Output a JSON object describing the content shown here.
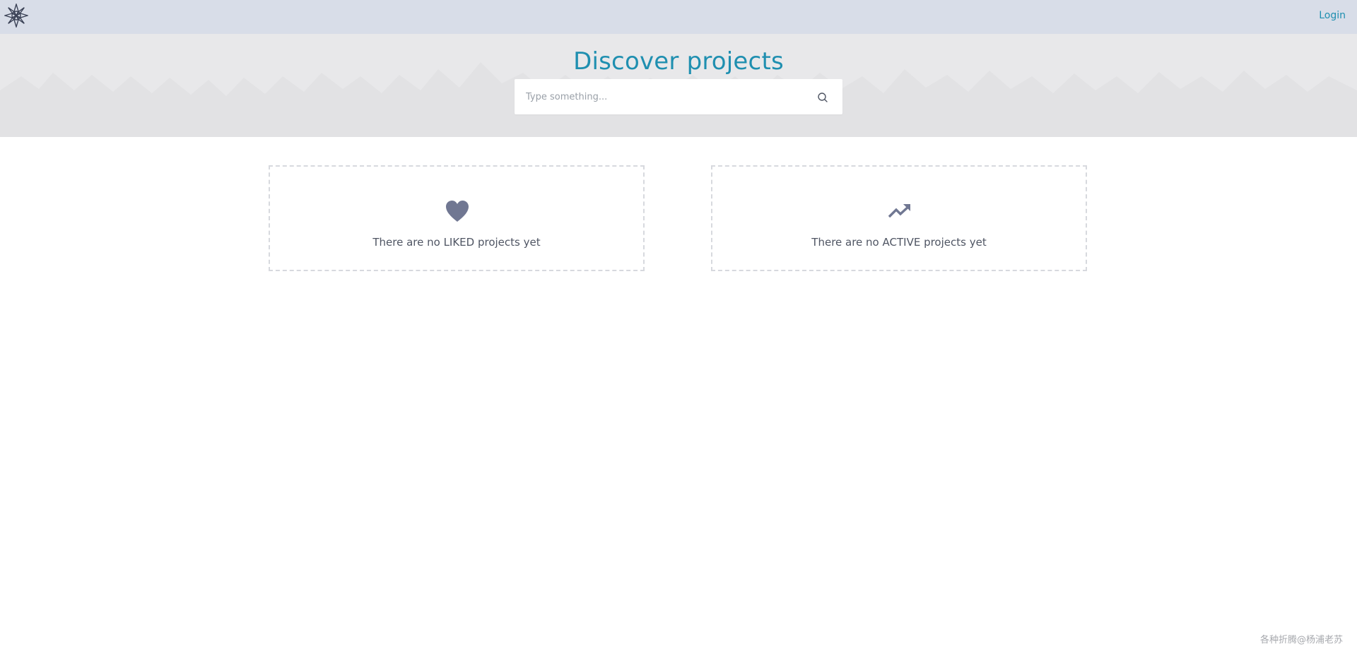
{
  "header": {
    "logo_icon": "snowflake-logo-icon",
    "login_label": "Login"
  },
  "hero": {
    "title": "Discover projects",
    "search": {
      "placeholder": "Type something...",
      "value": "",
      "icon": "search-icon"
    }
  },
  "cards": {
    "liked": {
      "icon": "heart-icon",
      "text": "There are no LIKED projects yet"
    },
    "active": {
      "icon": "trending-up-icon",
      "text": "There are no ACTIVE projects yet"
    }
  },
  "footer": {
    "watermark": "各种折腾@杨浦老苏"
  },
  "colors": {
    "accent": "#1f8fb0",
    "topbar_bg": "#d8dde8",
    "hero_bg": "#e8e8ea",
    "icon_color": "#707792",
    "card_border": "#d7d9de",
    "text_color": "#4f5563"
  }
}
